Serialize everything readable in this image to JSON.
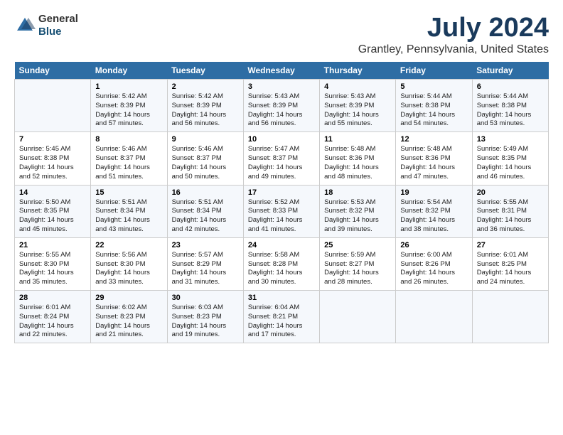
{
  "logo": {
    "general": "General",
    "blue": "Blue"
  },
  "title": "July 2024",
  "subtitle": "Grantley, Pennsylvania, United States",
  "days_header": [
    "Sunday",
    "Monday",
    "Tuesday",
    "Wednesday",
    "Thursday",
    "Friday",
    "Saturday"
  ],
  "weeks": [
    [
      {
        "num": "",
        "info": ""
      },
      {
        "num": "1",
        "info": "Sunrise: 5:42 AM\nSunset: 8:39 PM\nDaylight: 14 hours\nand 57 minutes."
      },
      {
        "num": "2",
        "info": "Sunrise: 5:42 AM\nSunset: 8:39 PM\nDaylight: 14 hours\nand 56 minutes."
      },
      {
        "num": "3",
        "info": "Sunrise: 5:43 AM\nSunset: 8:39 PM\nDaylight: 14 hours\nand 56 minutes."
      },
      {
        "num": "4",
        "info": "Sunrise: 5:43 AM\nSunset: 8:39 PM\nDaylight: 14 hours\nand 55 minutes."
      },
      {
        "num": "5",
        "info": "Sunrise: 5:44 AM\nSunset: 8:38 PM\nDaylight: 14 hours\nand 54 minutes."
      },
      {
        "num": "6",
        "info": "Sunrise: 5:44 AM\nSunset: 8:38 PM\nDaylight: 14 hours\nand 53 minutes."
      }
    ],
    [
      {
        "num": "7",
        "info": "Sunrise: 5:45 AM\nSunset: 8:38 PM\nDaylight: 14 hours\nand 52 minutes."
      },
      {
        "num": "8",
        "info": "Sunrise: 5:46 AM\nSunset: 8:37 PM\nDaylight: 14 hours\nand 51 minutes."
      },
      {
        "num": "9",
        "info": "Sunrise: 5:46 AM\nSunset: 8:37 PM\nDaylight: 14 hours\nand 50 minutes."
      },
      {
        "num": "10",
        "info": "Sunrise: 5:47 AM\nSunset: 8:37 PM\nDaylight: 14 hours\nand 49 minutes."
      },
      {
        "num": "11",
        "info": "Sunrise: 5:48 AM\nSunset: 8:36 PM\nDaylight: 14 hours\nand 48 minutes."
      },
      {
        "num": "12",
        "info": "Sunrise: 5:48 AM\nSunset: 8:36 PM\nDaylight: 14 hours\nand 47 minutes."
      },
      {
        "num": "13",
        "info": "Sunrise: 5:49 AM\nSunset: 8:35 PM\nDaylight: 14 hours\nand 46 minutes."
      }
    ],
    [
      {
        "num": "14",
        "info": "Sunrise: 5:50 AM\nSunset: 8:35 PM\nDaylight: 14 hours\nand 45 minutes."
      },
      {
        "num": "15",
        "info": "Sunrise: 5:51 AM\nSunset: 8:34 PM\nDaylight: 14 hours\nand 43 minutes."
      },
      {
        "num": "16",
        "info": "Sunrise: 5:51 AM\nSunset: 8:34 PM\nDaylight: 14 hours\nand 42 minutes."
      },
      {
        "num": "17",
        "info": "Sunrise: 5:52 AM\nSunset: 8:33 PM\nDaylight: 14 hours\nand 41 minutes."
      },
      {
        "num": "18",
        "info": "Sunrise: 5:53 AM\nSunset: 8:32 PM\nDaylight: 14 hours\nand 39 minutes."
      },
      {
        "num": "19",
        "info": "Sunrise: 5:54 AM\nSunset: 8:32 PM\nDaylight: 14 hours\nand 38 minutes."
      },
      {
        "num": "20",
        "info": "Sunrise: 5:55 AM\nSunset: 8:31 PM\nDaylight: 14 hours\nand 36 minutes."
      }
    ],
    [
      {
        "num": "21",
        "info": "Sunrise: 5:55 AM\nSunset: 8:30 PM\nDaylight: 14 hours\nand 35 minutes."
      },
      {
        "num": "22",
        "info": "Sunrise: 5:56 AM\nSunset: 8:30 PM\nDaylight: 14 hours\nand 33 minutes."
      },
      {
        "num": "23",
        "info": "Sunrise: 5:57 AM\nSunset: 8:29 PM\nDaylight: 14 hours\nand 31 minutes."
      },
      {
        "num": "24",
        "info": "Sunrise: 5:58 AM\nSunset: 8:28 PM\nDaylight: 14 hours\nand 30 minutes."
      },
      {
        "num": "25",
        "info": "Sunrise: 5:59 AM\nSunset: 8:27 PM\nDaylight: 14 hours\nand 28 minutes."
      },
      {
        "num": "26",
        "info": "Sunrise: 6:00 AM\nSunset: 8:26 PM\nDaylight: 14 hours\nand 26 minutes."
      },
      {
        "num": "27",
        "info": "Sunrise: 6:01 AM\nSunset: 8:25 PM\nDaylight: 14 hours\nand 24 minutes."
      }
    ],
    [
      {
        "num": "28",
        "info": "Sunrise: 6:01 AM\nSunset: 8:24 PM\nDaylight: 14 hours\nand 22 minutes."
      },
      {
        "num": "29",
        "info": "Sunrise: 6:02 AM\nSunset: 8:23 PM\nDaylight: 14 hours\nand 21 minutes."
      },
      {
        "num": "30",
        "info": "Sunrise: 6:03 AM\nSunset: 8:23 PM\nDaylight: 14 hours\nand 19 minutes."
      },
      {
        "num": "31",
        "info": "Sunrise: 6:04 AM\nSunset: 8:21 PM\nDaylight: 14 hours\nand 17 minutes."
      },
      {
        "num": "",
        "info": ""
      },
      {
        "num": "",
        "info": ""
      },
      {
        "num": "",
        "info": ""
      }
    ]
  ]
}
